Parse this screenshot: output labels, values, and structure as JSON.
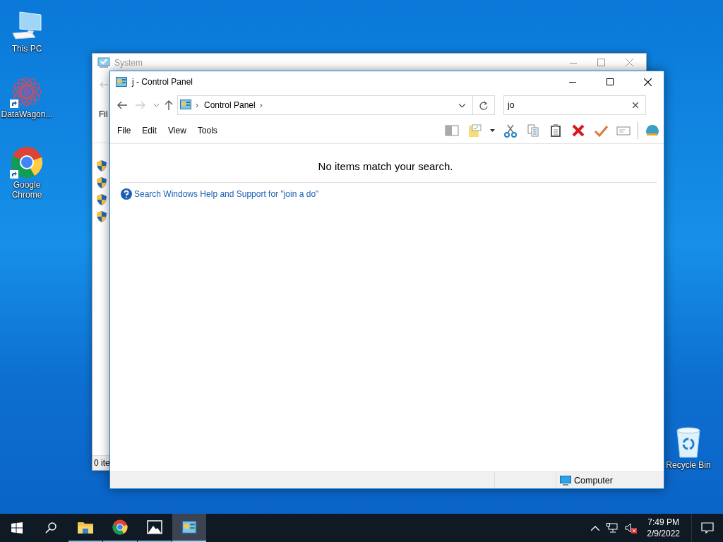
{
  "desktop_icons": [
    {
      "kind": "pc",
      "label": "This PC",
      "shortcut": false
    },
    {
      "kind": "app",
      "label": "DataWagon...",
      "shortcut": true
    },
    {
      "kind": "chrome",
      "label": "Google Chrome",
      "shortcut": true
    },
    {
      "kind": "bin",
      "label": "Recycle Bin",
      "shortcut": false
    }
  ],
  "back_window": {
    "title": "System",
    "menu_fragment": "Fil",
    "status_fragment": "0 ite"
  },
  "window": {
    "title": "j - Control Panel",
    "breadcrumb": [
      {
        "kind": "separator",
        "text": "›"
      },
      {
        "kind": "item",
        "text": "Control Panel"
      },
      {
        "kind": "separator",
        "text": "›"
      }
    ],
    "search": {
      "value": "jo"
    },
    "menu": [
      "File",
      "Edit",
      "View",
      "Tools"
    ],
    "message": "No items match your search.",
    "help_link": "Search Windows Help and Support for \"join a do\"",
    "status": "Computer"
  },
  "taskbar": {
    "apps": [
      {
        "kind": "explorer",
        "selected": false
      },
      {
        "kind": "chrome",
        "selected": false
      },
      {
        "kind": "photos",
        "selected": false
      },
      {
        "kind": "control-panel",
        "selected": true
      }
    ],
    "time": "7:49 PM",
    "date": "2/9/2022"
  }
}
